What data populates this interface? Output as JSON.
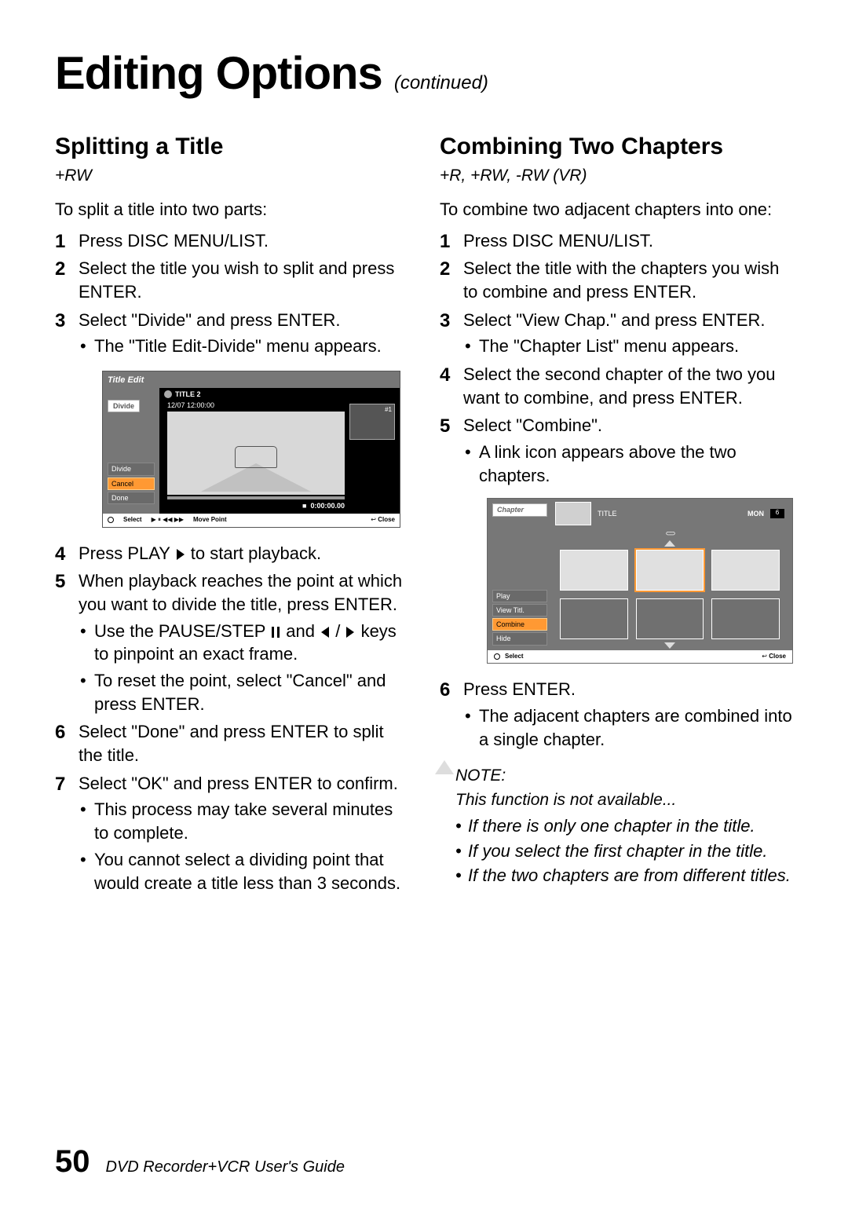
{
  "header": {
    "title": "Editing Options",
    "continued": "(continued)"
  },
  "left": {
    "title": "Splitting a Title",
    "formats": "+RW",
    "intro": "To split a title into two parts:",
    "steps": {
      "s1": "Press DISC MENU/LIST.",
      "s2": "Select the title you wish to split and press ENTER.",
      "s3": "Select \"Divide\" and press ENTER.",
      "s3_sub1": "The \"Title Edit-Divide\" menu appears.",
      "s4_pre": "Press PLAY ",
      "s4_post": " to start playback.",
      "s5": "When playback reaches the point at which you want to divide the title, press ENTER.",
      "s5_sub1_pre": "Use the PAUSE/STEP ",
      "s5_sub1_mid": " and ",
      "s5_sub1_sep": " / ",
      "s5_sub1_post": " keys to pinpoint an exact frame.",
      "s5_sub2": "To reset the point, select \"Cancel\" and press ENTER.",
      "s6": "Select \"Done\" and press ENTER to split the title.",
      "s7": "Select \"OK\" and press ENTER to confirm.",
      "s7_sub1": "This process may take several minutes to complete.",
      "s7_sub2": "You cannot select a dividing point that would create a title less than 3 seconds."
    },
    "screenshot": {
      "titlebar": "Title Edit",
      "tab": "Divide",
      "menu": {
        "divide": "Divide",
        "cancel": "Cancel",
        "done": "Done"
      },
      "title_label": "TITLE 2",
      "datetime": "12/07    12:00:00",
      "thumb_label": "#1",
      "timecode": "0:00:00.00",
      "bot_select": "Select",
      "bot_move": "Move Point",
      "bot_close": "Close",
      "bot_stop": "■"
    }
  },
  "right": {
    "title": "Combining Two Chapters",
    "formats": "+R, +RW, -RW (VR)",
    "intro": "To combine two adjacent chapters into one:",
    "steps": {
      "s1": "Press DISC MENU/LIST.",
      "s2": "Select the title with the chapters you wish to combine and press ENTER.",
      "s3": "Select \"View Chap.\" and press ENTER.",
      "s3_sub1": "The \"Chapter List\" menu appears.",
      "s4": "Select the second chapter of the two you want to combine, and press ENTER.",
      "s5": "Select \"Combine\".",
      "s5_sub1": "A link icon appears above the two chapters.",
      "s6": "Press ENTER.",
      "s6_sub1": "The adjacent chapters are combined into a single chapter."
    },
    "screenshot": {
      "tab": "Chapter",
      "menu": {
        "play": "Play",
        "view": "View Titl.",
        "combine": "Combine",
        "hide": "Hide"
      },
      "top_title": "TITLE",
      "top_mon": "Mon",
      "top_num": "6",
      "bot_select": "Select",
      "bot_close": "Close"
    },
    "note": {
      "head": "NOTE:",
      "body": "This function is not available...",
      "li1": "If there is only one chapter in the title.",
      "li2": "If you select the first chapter in the title.",
      "li3": "If the two chapters are from different titles."
    }
  },
  "footer": {
    "page": "50",
    "text": "DVD Recorder+VCR User's Guide"
  }
}
